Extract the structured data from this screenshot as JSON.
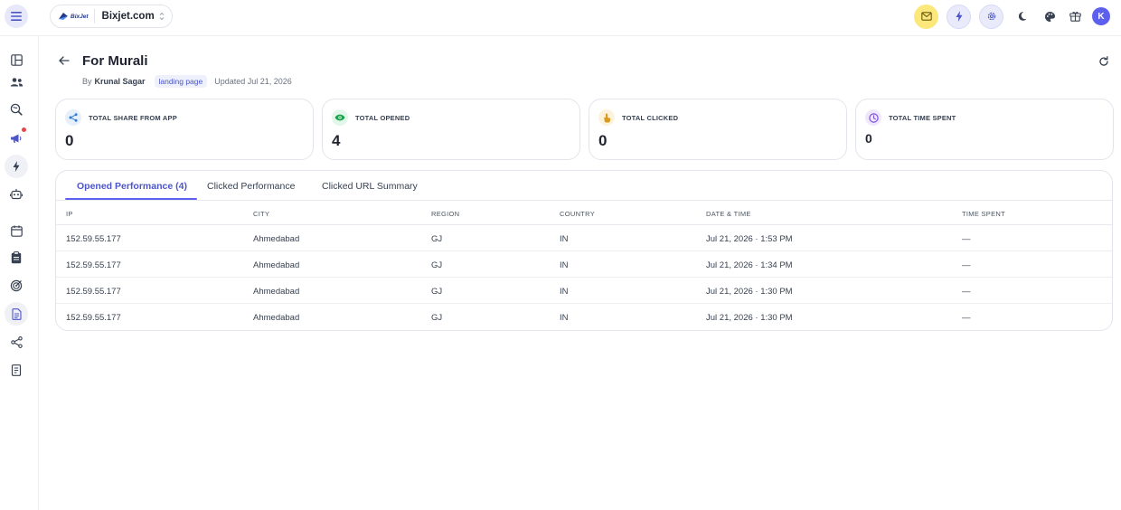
{
  "topbar": {
    "workspace_logo_text": "BixJet",
    "workspace_name": "Bixjet.com",
    "avatar_initial": "K"
  },
  "page": {
    "title": "For Murali",
    "by_prefix": "By",
    "author": "Krunal Sagar",
    "tag": "landing page",
    "updated": "Updated Jul 21, 2026"
  },
  "cards": [
    {
      "label": "TOTAL SHARE FROM APP",
      "value": "0",
      "icon": "share-icon",
      "color": "#2f7bd6",
      "bg": "#e6f0fb"
    },
    {
      "label": "TOTAL OPENED",
      "value": "4",
      "icon": "eye-icon",
      "color": "#16a34a",
      "bg": "#e3f6ea"
    },
    {
      "label": "TOTAL CLICKED",
      "value": "0",
      "icon": "pointer-icon",
      "color": "#d99a1e",
      "bg": "#fdf3dc"
    },
    {
      "label": "TOTAL TIME SPENT",
      "value": "0",
      "icon": "clock-icon",
      "color": "#7c4fd6",
      "bg": "#efe8fb"
    }
  ],
  "tabs": [
    {
      "label": "Opened Performance (4)",
      "active": true
    },
    {
      "label": "Clicked Performance",
      "active": false
    },
    {
      "label": "Clicked URL Summary",
      "active": false
    }
  ],
  "table": {
    "columns": [
      "IP",
      "CITY",
      "REGION",
      "COUNTRY",
      "DATE & TIME",
      "TIME SPENT"
    ],
    "rows": [
      [
        "152.59.55.177",
        "Ahmedabad",
        "GJ",
        "IN",
        "Jul 21, 2026 · 1:53 PM",
        "—"
      ],
      [
        "152.59.55.177",
        "Ahmedabad",
        "GJ",
        "IN",
        "Jul 21, 2026 · 1:34 PM",
        "—"
      ],
      [
        "152.59.55.177",
        "Ahmedabad",
        "GJ",
        "IN",
        "Jul 21, 2026 · 1:30 PM",
        "—"
      ],
      [
        "152.59.55.177",
        "Ahmedabad",
        "GJ",
        "IN",
        "Jul 21, 2026 · 1:30 PM",
        "—"
      ]
    ]
  },
  "colors": {
    "accent": "#5d5fef",
    "mail_button_bg": "#fbe77a",
    "badge": "#e04a4a"
  }
}
